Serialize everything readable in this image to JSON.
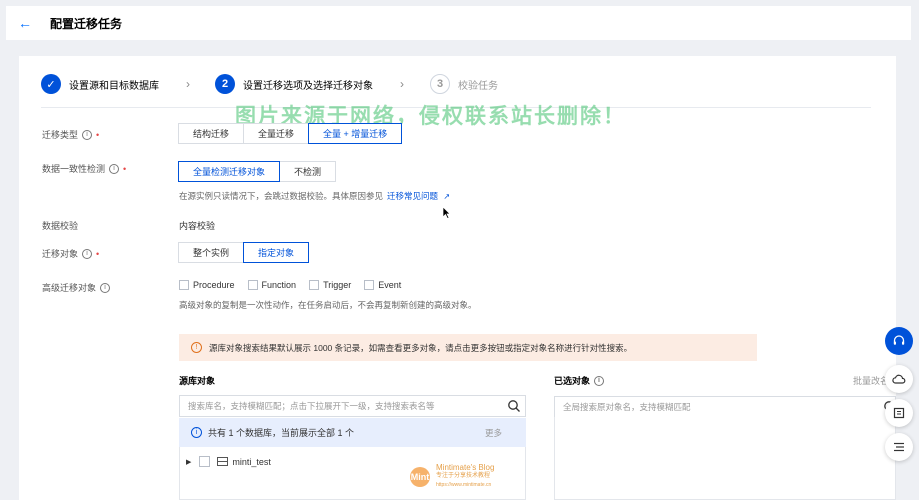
{
  "header": {
    "title": "配置迁移任务"
  },
  "steps": [
    {
      "num": "✓",
      "label": "设置源和目标数据库",
      "state": "done"
    },
    {
      "num": "2",
      "label": "设置迁移选项及选择迁移对象",
      "state": "active"
    },
    {
      "num": "3",
      "label": "校验任务",
      "state": "todo"
    }
  ],
  "watermark": "图片来源于网络，侵权联系站长删除！",
  "migration_type": {
    "label": "迁移类型",
    "options": [
      "结构迁移",
      "全量迁移",
      "全量 + 增量迁移"
    ],
    "selected": "全量 + 增量迁移"
  },
  "consistency": {
    "label": "数据一致性检测",
    "options": [
      "全量检测迁移对象",
      "不检测"
    ],
    "selected": "全量检测迁移对象",
    "hint": "在源实例只读情况下，会跳过数据校验。具体原因参见",
    "hint_link": "迁移常见问题"
  },
  "data_check": {
    "label": "数据校验",
    "value": "内容校验"
  },
  "migrate_object": {
    "label": "迁移对象",
    "options": [
      "整个实例",
      "指定对象"
    ],
    "selected": "指定对象"
  },
  "advanced": {
    "label": "高级迁移对象",
    "options": [
      "Procedure",
      "Function",
      "Trigger",
      "Event"
    ],
    "hint": "高级对象的复制是一次性动作，在任务启动后，不会再复制新创建的高级对象。"
  },
  "notice": "源库对象搜索结果默认展示 1000 条记录，如需查看更多对象，请点击更多按钮或指定对象名称进行针对性搜索。",
  "source": {
    "title": "源库对象",
    "placeholder": "搜索库名，支持模糊匹配；点击下拉展开下一级，支持搜索表名等",
    "info": "共有 1 个数据库，当前展示全部 1 个",
    "more": "更多",
    "db": "minti_test"
  },
  "selected": {
    "title": "已选对象",
    "placeholder": "全局搜索原对象名，支持模糊匹配",
    "batch": "批量改名"
  },
  "blog": {
    "name": "Mintimate's Blog",
    "sub": "专注于分享技术教程",
    "url": "https://www.mintimate.cn",
    "logo": "Mint"
  },
  "colors": {
    "primary": "#0052d9",
    "notice_bg": "#fcece3",
    "info_bg": "#e7eefd",
    "watermark": "#43c26e"
  }
}
